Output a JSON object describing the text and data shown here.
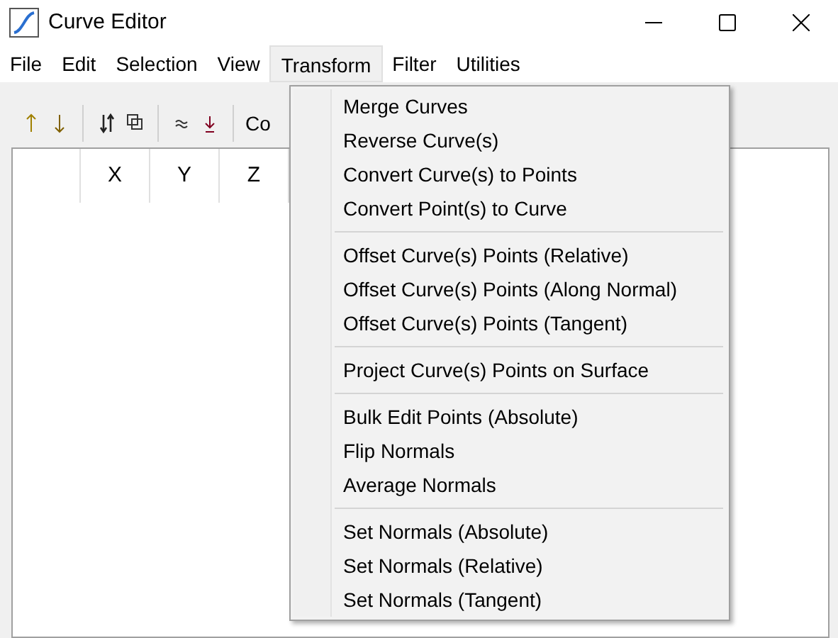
{
  "window": {
    "title": "Curve Editor"
  },
  "menu_bar": [
    {
      "label": "File",
      "selected": false
    },
    {
      "label": "Edit",
      "selected": false
    },
    {
      "label": "Selection",
      "selected": false
    },
    {
      "label": "View",
      "selected": false
    },
    {
      "label": "Transform",
      "selected": true
    },
    {
      "label": "Filter",
      "selected": false
    },
    {
      "label": "Utilities",
      "selected": false
    }
  ],
  "toolbar": {
    "buttons": [
      {
        "kind": "up"
      },
      {
        "kind": "down"
      },
      {
        "kind": "sep"
      },
      {
        "kind": "swap"
      },
      {
        "kind": "copy"
      },
      {
        "kind": "sep"
      },
      {
        "kind": "approx"
      },
      {
        "kind": "ground"
      },
      {
        "kind": "sep"
      }
    ],
    "label": "Co"
  },
  "table": {
    "columns": [
      "",
      "X",
      "Y",
      "Z"
    ]
  },
  "dropdown": {
    "groups": [
      [
        "Merge Curves",
        "Reverse Curve(s)",
        "Convert Curve(s) to Points",
        "Convert Point(s) to Curve"
      ],
      [
        "Offset Curve(s) Points (Relative)",
        "Offset Curve(s) Points (Along Normal)",
        "Offset Curve(s) Points (Tangent)"
      ],
      [
        "Project Curve(s) Points on Surface"
      ],
      [
        "Bulk Edit Points (Absolute)",
        "Flip Normals",
        "Average Normals"
      ],
      [
        "Set Normals (Absolute)",
        "Set Normals (Relative)",
        "Set Normals (Tangent)"
      ]
    ]
  }
}
